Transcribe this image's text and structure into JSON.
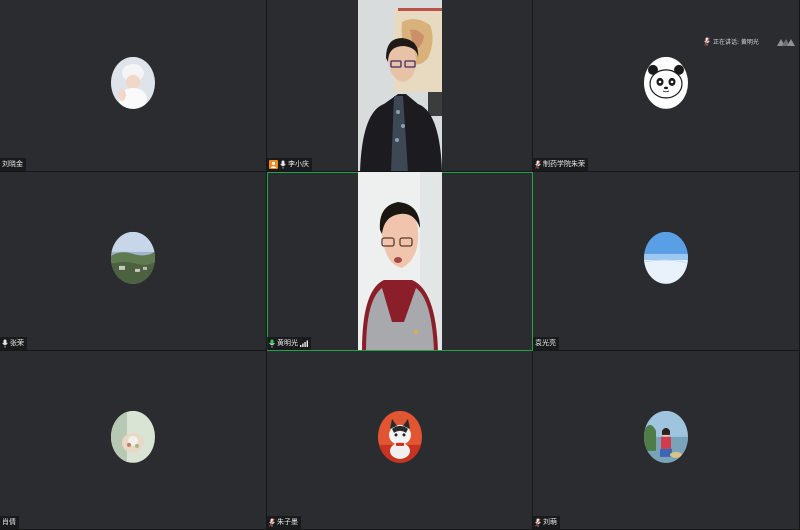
{
  "speaking_indicator": {
    "label": "正在讲话: 黄明光"
  },
  "tiles": [
    {
      "name": "刘晓金",
      "mic": "none"
    },
    {
      "name": "李小庆",
      "mic": "on",
      "camera_badge": true
    },
    {
      "name": "制药学院朱荣",
      "mic": "muted"
    },
    {
      "name": "张荣",
      "mic": "on"
    },
    {
      "name": "黄明光",
      "mic": "speaking",
      "signal": true,
      "active": true
    },
    {
      "name": "袁光亮",
      "mic": "none"
    },
    {
      "name": "肖倩",
      "mic": "none"
    },
    {
      "name": "朱子墨",
      "mic": "muted"
    },
    {
      "name": "刘萌",
      "mic": "muted"
    }
  ],
  "colors": {
    "active_border": "#1fa44a",
    "tile_bg": "#2b2c2f",
    "camera_badge": "#f08a1c"
  }
}
